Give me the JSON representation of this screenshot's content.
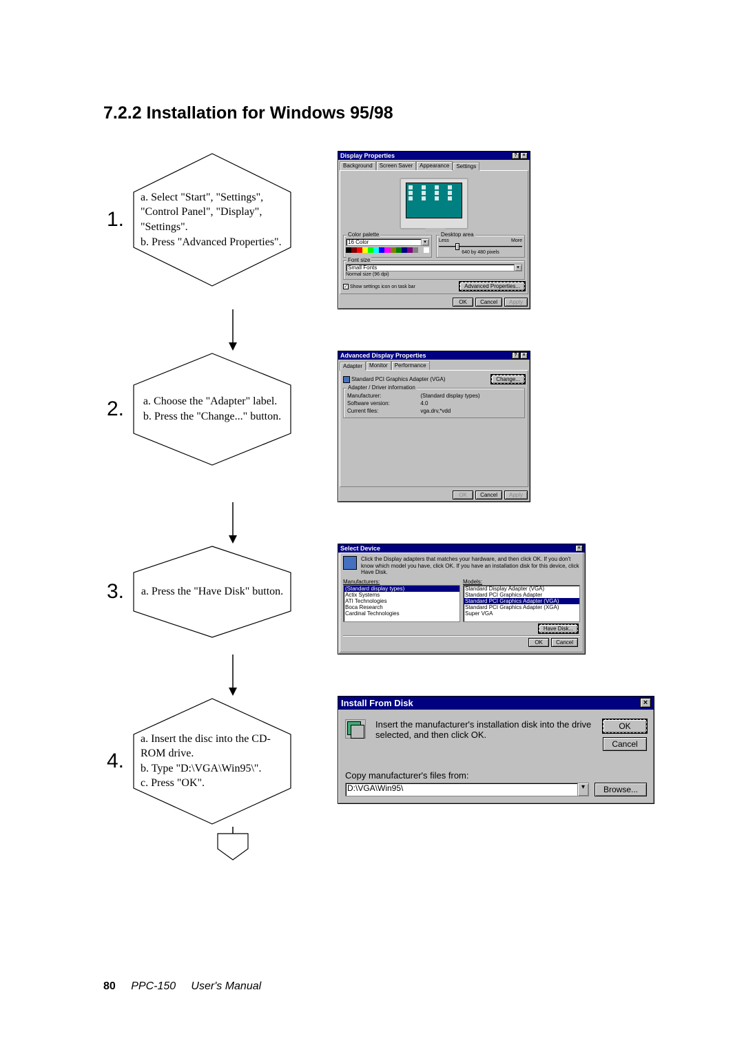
{
  "title": "7.2.2 Installation for Windows 95/98",
  "footer": {
    "page": "80",
    "book": "PPC-150",
    "section": "User's Manual"
  },
  "steps": [
    {
      "num": "1.",
      "text": "a.  Select \"Start\", \"Settings\", \"Control Panel\", \"Display\", \"Settings\".\nb.  Press \"Advanced Properties\"."
    },
    {
      "num": "2.",
      "text": "a.  Choose the \"Adapter\" label.\nb.  Press the \"Change...\" button."
    },
    {
      "num": "3.",
      "text": "a.  Press the \"Have Disk\" button."
    },
    {
      "num": "4.",
      "text": "a.  Insert the disc into the CD-ROM drive.\nb.  Type \"D:\\VGA\\Win95\\\".\nc.  Press \"OK\"."
    }
  ],
  "dialog1": {
    "title": "Display Properties",
    "tabs": [
      "Background",
      "Screen Saver",
      "Appearance",
      "Settings"
    ],
    "active_tab": "Settings",
    "color_label": "Color palette",
    "color_value": "16 Color",
    "area_label": "Desktop area",
    "area_less": "Less",
    "area_more": "More",
    "area_value": "640 by 480 pixels",
    "font_label": "Font size",
    "font_value": "Small Fonts",
    "font_dpi": "Normal size (96 dpi)",
    "checkbox": "Show settings icon on task bar",
    "adv_btn": "Advanced Properties...",
    "ok": "OK",
    "cancel": "Cancel",
    "apply": "Apply"
  },
  "dialog2": {
    "title": "Advanced Display Properties",
    "tabs": [
      "Adapter",
      "Monitor",
      "Performance"
    ],
    "device": "Standard PCI Graphics Adapter (VGA)",
    "change": "Change...",
    "info_label": "Adapter / Driver information",
    "manufacturer_l": "Manufacturer:",
    "manufacturer_v": "(Standard display types)",
    "software_l": "Software version:",
    "software_v": "4.0",
    "current_l": "Current files:",
    "current_v": "vga.drv,*vdd",
    "ok": "OK",
    "cancel": "Cancel",
    "apply": "Apply"
  },
  "dialog3": {
    "title": "Select Device",
    "instr": "Click the Display adapters that matches your hardware, and then click OK. If you don't know which model you have, click OK. If you have an installation disk for this device, click Have Disk.",
    "manu_label": "Manufacturers:",
    "model_label": "Models:",
    "manufacturers": [
      "(Standard display types)",
      "Actix Systems",
      "ATI Technologies",
      "Boca Research",
      "Cardinal Technologies"
    ],
    "models": [
      "Standard Display Adapter (VGA)",
      "Standard PCI Graphics Adapter",
      "Standard PCI Graphics Adapter (VGA)",
      "Standard PCI Graphics Adapter (XGA)",
      "Super VGA"
    ],
    "sel_manu": 0,
    "sel_model": 2,
    "have_disk": "Have Disk...",
    "ok": "OK",
    "cancel": "Cancel"
  },
  "dialog4": {
    "title": "Install From Disk",
    "instr": "Insert the manufacturer's installation disk into the drive selected, and then click OK.",
    "copy_label": "Copy manufacturer's files from:",
    "path": "D:\\VGA\\Win95\\",
    "ok": "OK",
    "cancel": "Cancel",
    "browse": "Browse..."
  }
}
